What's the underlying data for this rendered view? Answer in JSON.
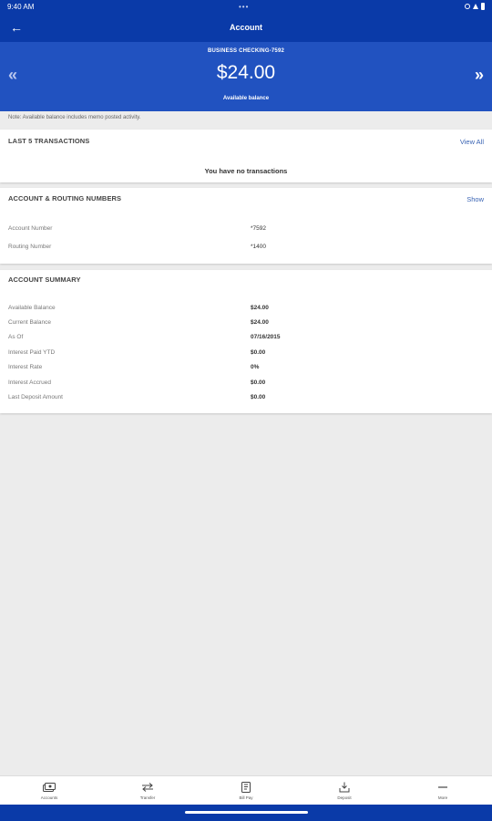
{
  "status_bar": {
    "time": "9:40 AM",
    "dots": "•••"
  },
  "header": {
    "title": "Account",
    "back_glyph": "←"
  },
  "hero": {
    "account_name": "BUSINESS CHECKING-7592",
    "balance": "$24.00",
    "balance_label": "Available balance",
    "prev_glyph": "«",
    "next_glyph": "»"
  },
  "note": "Note: Available balance includes memo posted activity.",
  "transactions": {
    "title": "LAST 5 TRANSACTIONS",
    "view_all": "View All",
    "empty_text": "You have no transactions"
  },
  "routing": {
    "title": "ACCOUNT & ROUTING NUMBERS",
    "show": "Show",
    "rows": [
      {
        "label": "Account Number",
        "value": "*7592"
      },
      {
        "label": "Routing Number",
        "value": "*1400"
      }
    ]
  },
  "summary": {
    "title": "ACCOUNT SUMMARY",
    "rows": [
      {
        "label": "Available Balance",
        "value": "$24.00"
      },
      {
        "label": "Current Balance",
        "value": "$24.00"
      },
      {
        "label": "As Of",
        "value": "07/16/2015"
      },
      {
        "label": "Interest Paid YTD",
        "value": "$0.00"
      },
      {
        "label": "Interest Rate",
        "value": "0%"
      },
      {
        "label": "Interest Accrued",
        "value": "$0.00"
      },
      {
        "label": "Last Deposit Amount",
        "value": "$0.00"
      }
    ]
  },
  "bottom_nav": [
    {
      "label": "Accounts",
      "icon": "accounts-icon"
    },
    {
      "label": "Transfer",
      "icon": "transfer-icon"
    },
    {
      "label": "Bill Pay",
      "icon": "bill-pay-icon"
    },
    {
      "label": "Deposit",
      "icon": "deposit-icon"
    },
    {
      "label": "More",
      "icon": "more-icon"
    }
  ],
  "colors": {
    "primary": "#0a3aa8",
    "hero": "#2152c0",
    "link": "#3a64b4",
    "background": "#ececec"
  }
}
